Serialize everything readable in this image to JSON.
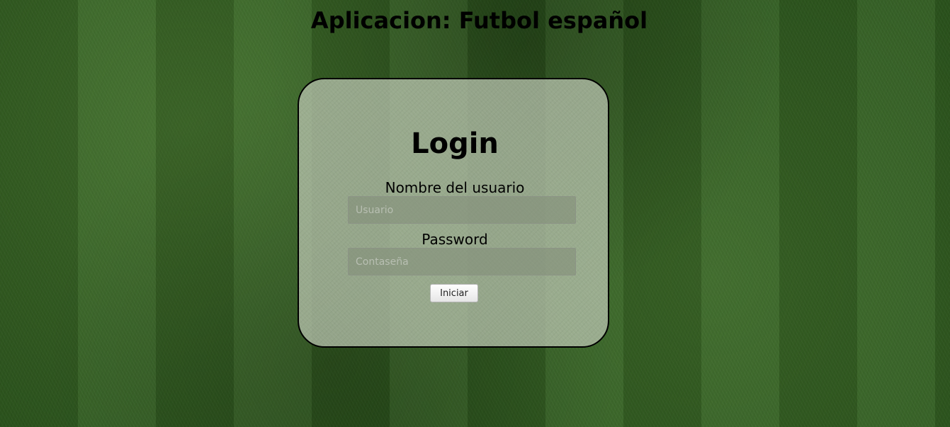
{
  "page": {
    "title": "Aplicacion: Futbol español"
  },
  "login": {
    "heading": "Login",
    "username": {
      "label": "Nombre del usuario",
      "placeholder": "Usuario",
      "value": ""
    },
    "password": {
      "label": "Password",
      "placeholder": "Contaseña",
      "value": ""
    },
    "submit_label": "Iniciar"
  },
  "colors": {
    "background": "#2f5a1f",
    "card_background": "#bec8b4",
    "card_border": "#000000"
  }
}
